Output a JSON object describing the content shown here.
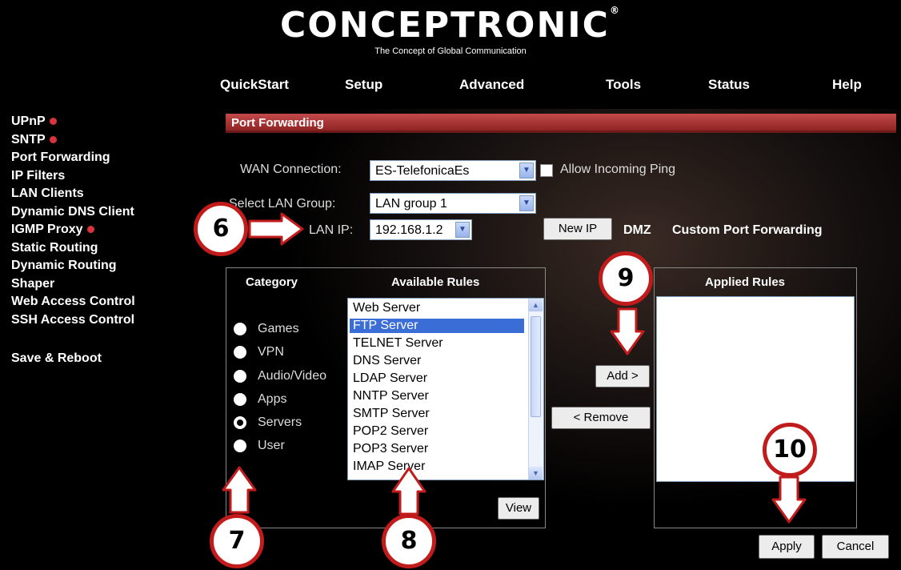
{
  "brand": {
    "logo": "CONCEPTRONIC",
    "reg": "®",
    "tagline": "The Concept of Global Communication"
  },
  "nav": [
    {
      "label": "QuickStart"
    },
    {
      "label": "Setup"
    },
    {
      "label": "Advanced"
    },
    {
      "label": "Tools"
    },
    {
      "label": "Status"
    },
    {
      "label": "Help"
    }
  ],
  "sidebar": {
    "items": [
      {
        "label": "UPnP",
        "badge": true
      },
      {
        "label": "SNTP",
        "badge": true
      },
      {
        "label": "Port Forwarding"
      },
      {
        "label": "IP Filters"
      },
      {
        "label": "LAN Clients"
      },
      {
        "label": "Dynamic DNS Client"
      },
      {
        "label": "IGMP Proxy",
        "badge": true
      },
      {
        "label": "Static Routing"
      },
      {
        "label": "Dynamic Routing"
      },
      {
        "label": "Shaper"
      },
      {
        "label": "Web Access Control"
      },
      {
        "label": "SSH Access Control"
      }
    ],
    "save": "Save & Reboot"
  },
  "page": {
    "title": "Port Forwarding"
  },
  "form": {
    "wan_label": "WAN Connection:",
    "wan_value": "ES-TelefonicaEs",
    "ping_label": "Allow Incoming Ping",
    "group_label": "Select LAN Group:",
    "group_value": "LAN group 1",
    "ip_label": "LAN IP:",
    "ip_value": "192.168.1.2",
    "newip": "New IP",
    "dmz": "DMZ",
    "custom": "Custom Port Forwarding"
  },
  "category": {
    "title": "Category",
    "items": [
      {
        "label": "Games"
      },
      {
        "label": "VPN"
      },
      {
        "label": "Audio/Video"
      },
      {
        "label": "Apps"
      },
      {
        "label": "Servers",
        "selected": true
      },
      {
        "label": "User"
      }
    ]
  },
  "available": {
    "title": "Available Rules",
    "items": [
      {
        "label": "Web Server"
      },
      {
        "label": "FTP Server",
        "selected": true
      },
      {
        "label": "TELNET Server"
      },
      {
        "label": "DNS Server"
      },
      {
        "label": "LDAP Server"
      },
      {
        "label": "NNTP Server"
      },
      {
        "label": "SMTP Server"
      },
      {
        "label": "POP2 Server"
      },
      {
        "label": "POP3 Server"
      },
      {
        "label": "IMAP Server"
      }
    ],
    "view": "View"
  },
  "actions": {
    "add": "Add >",
    "remove": "< Remove",
    "apply": "Apply",
    "cancel": "Cancel"
  },
  "applied": {
    "title": "Applied Rules"
  },
  "callouts": [
    "6",
    "7",
    "8",
    "9",
    "10"
  ],
  "colors": {
    "accent_red": "#c21b1b",
    "section_bar": "#b03a3a",
    "selection": "#3a6dd6"
  }
}
